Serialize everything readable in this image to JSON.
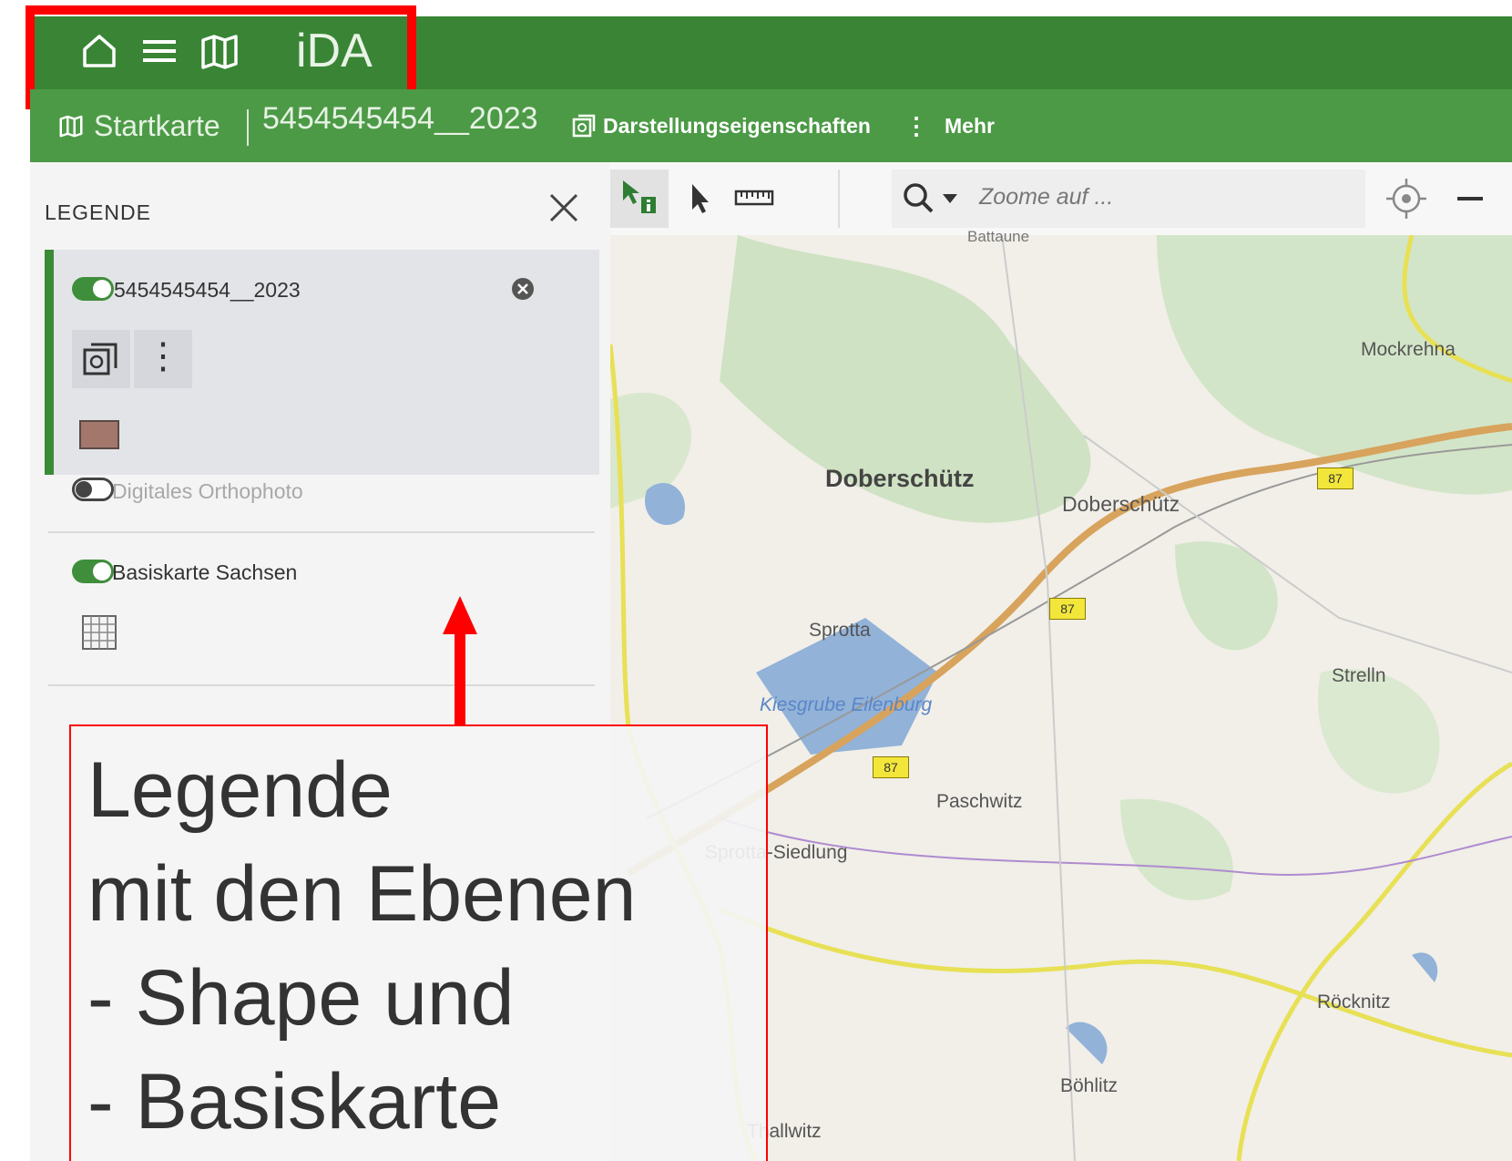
{
  "topbar": {
    "brand": "iDA",
    "icons": [
      "home-icon",
      "menu-icon",
      "map-icon"
    ]
  },
  "subbar": {
    "map_name": "Startkarte",
    "project": "5454545454__2023",
    "display_properties": "Darstellungseigenschaften",
    "more": "Mehr"
  },
  "legend": {
    "title": "LEGENDE",
    "layers": [
      {
        "name": "5454545454__2023",
        "enabled": true,
        "swatch_color": "#a4776c"
      },
      {
        "name": "Digitales Orthophoto",
        "enabled": false
      },
      {
        "name": "Basiskarte Sachsen",
        "enabled": true
      }
    ]
  },
  "map_toolbar": {
    "search_placeholder": "Zoome auf ..."
  },
  "map_labels": {
    "battaune": "Battaune",
    "mockrehna": "Mockrehna",
    "doberschuetz_big": "Doberschütz",
    "doberschuetz": "Doberschütz",
    "sprotta": "Sprotta",
    "kiesgrube": "Kiesgrube Eilenburg",
    "strelln": "Strelln",
    "paschwitz": "Paschwitz",
    "sprotta_siedlung": "Sprotta-Siedlung",
    "rocknitz": "Röcknitz",
    "bohlitz": "Böhlitz",
    "thallwitz": "Thallwitz",
    "road_87": "87"
  },
  "annotation": {
    "line1": "Legende",
    "line2": "mit den Ebenen",
    "line3": "- Shape und",
    "line4": "- Basiskarte"
  },
  "colors": {
    "topbar": "#398535",
    "subbar": "#4c9a46",
    "highlight": "#ff0000",
    "toggle_on": "#3f8e3b"
  }
}
